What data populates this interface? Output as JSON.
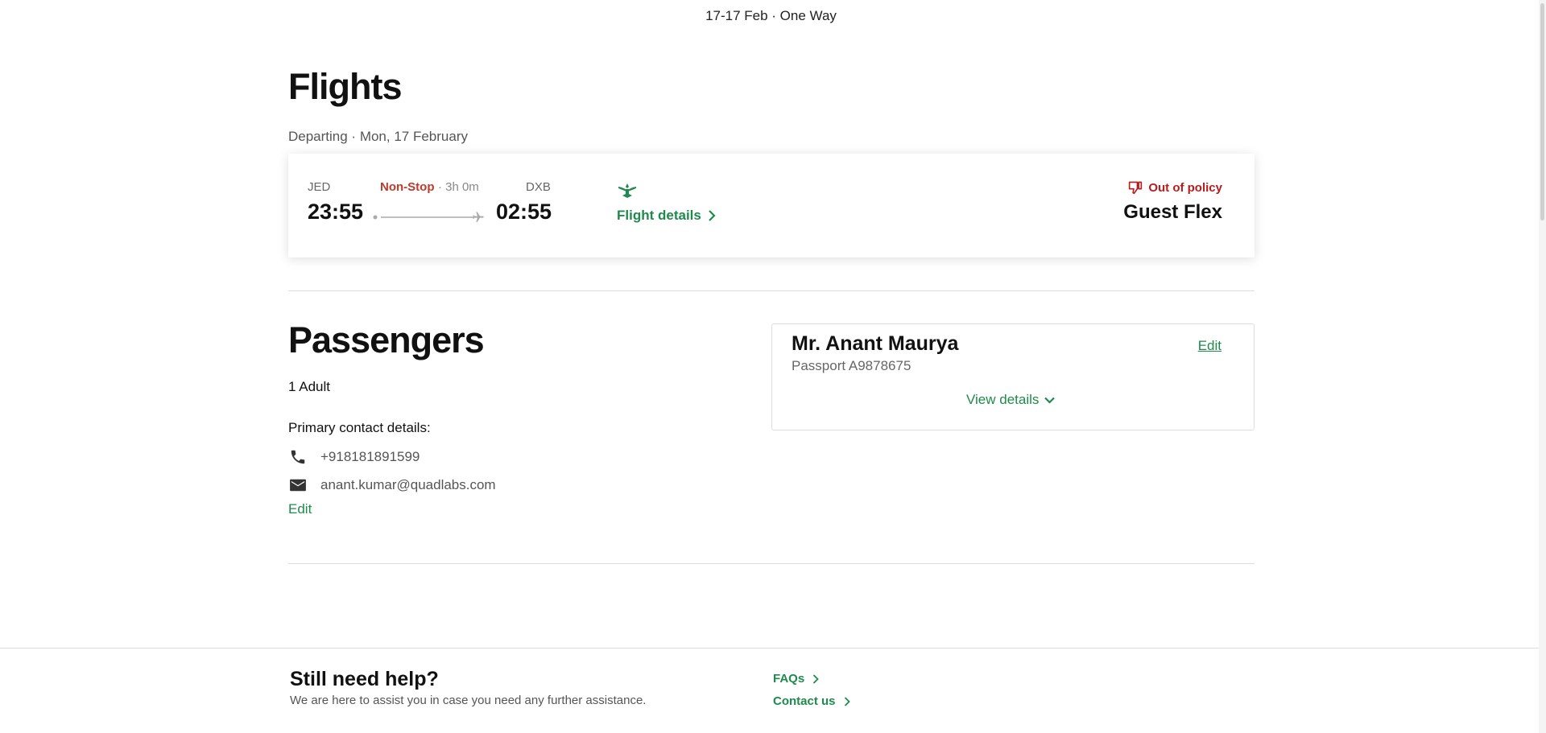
{
  "header": {
    "trip_summary": "17-17 Feb · One Way"
  },
  "flights": {
    "title": "Flights",
    "departing_label": "Departing · Mon, 17 February",
    "card": {
      "origin_code": "JED",
      "origin_time": "23:55",
      "stop_label": "Non-Stop",
      "duration": "· 3h 0m",
      "destination_code": "DXB",
      "destination_time": "02:55",
      "airline_logo_icon": "airline-emblem-icon",
      "details_link": "Flight details",
      "policy_label": "Out of policy",
      "fare_name": "Guest Flex"
    }
  },
  "passengers": {
    "title": "Passengers",
    "count_label": "1 Adult",
    "contact_heading": "Primary contact details:",
    "phone": "+918181891599",
    "email": "anant.kumar@quadlabs.com",
    "edit_label": "Edit",
    "card": {
      "name": "Mr. Anant Maurya",
      "passport": "Passport A9878675",
      "edit_label": "Edit",
      "view_details_label": "View details"
    }
  },
  "footer": {
    "help_title": "Still need help?",
    "help_subtitle": "We are here to assist you in case you need any further assistance.",
    "links": [
      "FAQs",
      "Contact us"
    ]
  },
  "colors": {
    "accent_green": "#1f8a4c",
    "policy_red": "#b71c1c",
    "nonstop_red": "#c0392b"
  }
}
